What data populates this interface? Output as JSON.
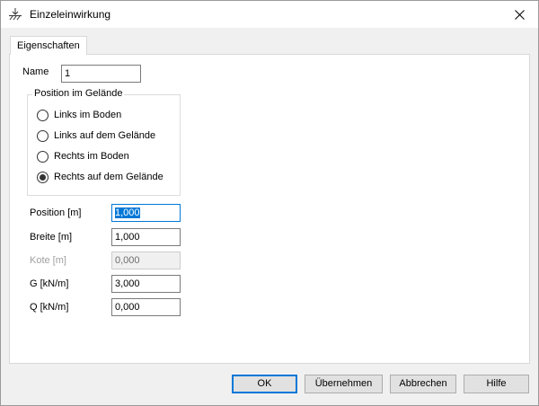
{
  "window": {
    "title": "Einzeleinwirkung",
    "app_icon": "soil-surface-icon",
    "close_glyph": "✕"
  },
  "tabs": [
    {
      "label": "Eigenschaften",
      "active": true
    }
  ],
  "form": {
    "name_label": "Name",
    "name_value": "1",
    "position_group": {
      "caption": "Position im Gelände",
      "options": [
        {
          "label": "Links im Boden",
          "checked": false
        },
        {
          "label": "Links auf dem Gelände",
          "checked": false
        },
        {
          "label": "Rechts im Boden",
          "checked": false
        },
        {
          "label": "Rechts auf dem Gelände",
          "checked": true
        }
      ]
    },
    "fields": [
      {
        "label": "Position [m]",
        "value": "1,000",
        "enabled": true,
        "focused": true
      },
      {
        "label": "Breite [m]",
        "value": "1,000",
        "enabled": true,
        "focused": false
      },
      {
        "label": "Kote [m]",
        "value": "0,000",
        "enabled": false,
        "focused": false
      },
      {
        "label": "G [kN/m]",
        "value": "3,000",
        "enabled": true,
        "focused": false
      },
      {
        "label": "Q [kN/m]",
        "value": "0,000",
        "enabled": true,
        "focused": false
      }
    ]
  },
  "buttons": {
    "ok": "OK",
    "apply": "Übernehmen",
    "cancel": "Abbrechen",
    "help": "Hilfe"
  },
  "colors": {
    "accent": "#0078d7",
    "dialog_background": "#f0f0f0",
    "panel_background": "#ffffff"
  }
}
